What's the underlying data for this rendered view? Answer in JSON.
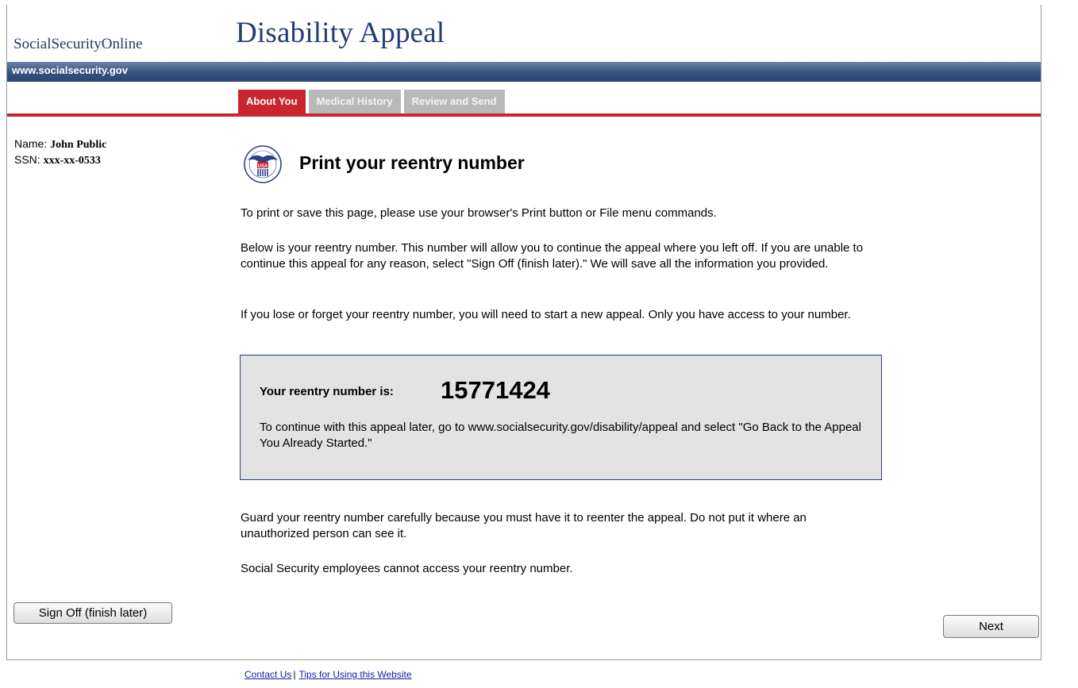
{
  "header": {
    "brand": "SocialSecurityOnline",
    "app_title": "Disability Appeal",
    "url_text": "www.socialsecurity.gov"
  },
  "tabs": [
    {
      "label": "About You",
      "active": true
    },
    {
      "label": "Medical History",
      "active": false
    },
    {
      "label": "Review and Send",
      "active": false
    }
  ],
  "user": {
    "name_label": "Name:",
    "name_value": "John Public",
    "ssn_label": "SSN:",
    "ssn_value": "xxx-xx-0533"
  },
  "main": {
    "heading": "Print your reentry number",
    "seal_text": "USA",
    "para_print": "To print or save this page, please use your browser's Print button or File menu commands.",
    "para_below": "Below is your reentry number. This number will allow you to continue the appeal where you left off. If you are unable to continue this appeal for any reason, select \"Sign Off (finish later).\" We will save all the information you provided.",
    "para_lose": "If you lose or forget your reentry number, you will need to start a new appeal. Only you have access to your number.",
    "reentry_label": "Your reentry number is:",
    "reentry_number": "15771424",
    "reentry_note": "To continue with this appeal later, go to www.socialsecurity.gov/disability/appeal and select \"Go Back to the Appeal You Already Started.\"",
    "para_guard": "Guard your reentry number carefully because you must have it to reenter the appeal. Do not put it where an unauthorized person can see it.",
    "para_employees": "Social Security employees cannot access your reentry number."
  },
  "buttons": {
    "sign_off": "Sign Off (finish later)",
    "next": "Next"
  },
  "footer": {
    "contact": "Contact Us",
    "separator": "|",
    "tips": "Tips for Using this Website"
  },
  "colors": {
    "accent_red": "#c8262c",
    "header_blue": "#2b4770",
    "title_blue": "#233d7b"
  }
}
